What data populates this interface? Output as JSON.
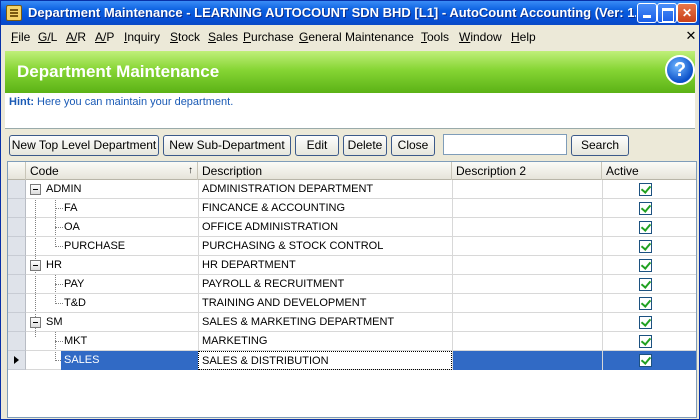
{
  "window": {
    "title": "Department Maintenance - LEARNING AUTOCOUNT SDN BHD [L1] - AutoCount Accounting (Ver: 1..."
  },
  "menubar": {
    "items": [
      "File",
      "G/L",
      "A/R",
      "A/P",
      "Inquiry",
      "Stock",
      "Sales",
      "Purchase",
      "General Maintenance",
      "Tools",
      "Window",
      "Help"
    ],
    "mdi_close": "✕"
  },
  "header": {
    "title": "Department Maintenance",
    "help_glyph": "?"
  },
  "hint": {
    "label": "Hint:",
    "text": "Here you can maintain your department."
  },
  "toolbar": {
    "new_top_level": "New Top Level Department",
    "new_sub": "New Sub-Department",
    "edit": "Edit",
    "delete": "Delete",
    "close": "Close",
    "search_value": "",
    "search": "Search"
  },
  "grid": {
    "columns": {
      "code": "Code",
      "description": "Description",
      "description2": "Description 2",
      "active": "Active"
    },
    "sort_glyph": "↑",
    "rows": [
      {
        "code": "ADMIN",
        "description": "ADMINISTRATION DEPARTMENT",
        "description2": "",
        "active": true
      },
      {
        "code": "FA",
        "description": "FINCANCE & ACCOUNTING",
        "description2": "",
        "active": true
      },
      {
        "code": "OA",
        "description": "OFFICE ADMINISTRATION",
        "description2": "",
        "active": true
      },
      {
        "code": "PURCHASE",
        "description": "PURCHASING & STOCK CONTROL",
        "description2": "",
        "active": true
      },
      {
        "code": "HR",
        "description": "HR DEPARTMENT",
        "description2": "",
        "active": true
      },
      {
        "code": "PAY",
        "description": "PAYROLL & RECRUITMENT",
        "description2": "",
        "active": true
      },
      {
        "code": "T&D",
        "description": "TRAINING AND DEVELOPMENT",
        "description2": "",
        "active": true
      },
      {
        "code": "SM",
        "description": "SALES & MARKETING DEPARTMENT",
        "description2": "",
        "active": true
      },
      {
        "code": "MKT",
        "description": "MARKETING",
        "description2": "",
        "active": true
      },
      {
        "code": "SALES",
        "description": "SALES & DISTRIBUTION",
        "description2": "",
        "active": true
      }
    ]
  },
  "colors": {
    "titlebar": "#0551d8",
    "header_green": "#86d534",
    "selection": "#316ac5",
    "hint_text": "#1a5ab5"
  }
}
